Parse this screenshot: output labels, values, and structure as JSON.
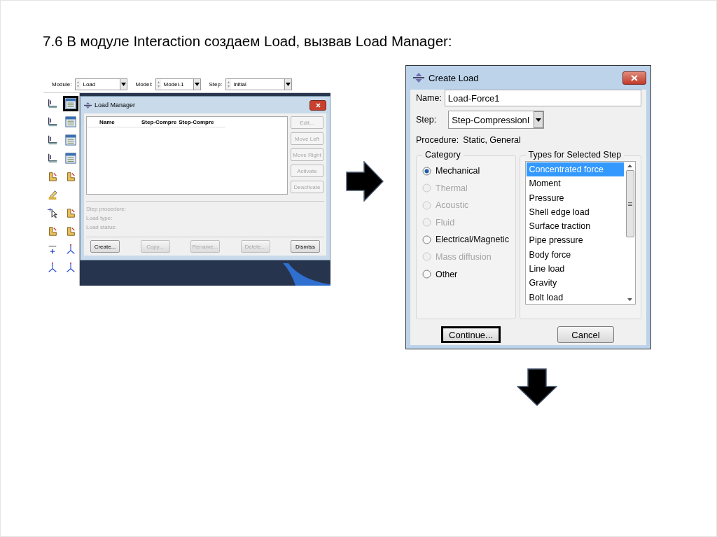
{
  "heading": "7.6 В модуле Interaction создаем Load, вызвав Load Manager:",
  "abaqus_screenshot": {
    "context_bar": [
      {
        "label": "Module:",
        "value": "Load"
      },
      {
        "label": "Model:",
        "value": "Model-1"
      },
      {
        "label": "Step:",
        "value": "Initial"
      }
    ],
    "toolbox": [
      {
        "kind": "support",
        "selected": false
      },
      {
        "kind": "manager",
        "selected": true
      },
      {
        "kind": "support",
        "selected": false
      },
      {
        "kind": "manager",
        "selected": false
      },
      {
        "kind": "support",
        "selected": false
      },
      {
        "kind": "manager",
        "selected": false
      },
      {
        "kind": "support",
        "selected": false
      },
      {
        "kind": "manager",
        "selected": false
      },
      {
        "kind": "part",
        "selected": false
      },
      {
        "kind": "part",
        "selected": false
      },
      {
        "kind": "pencil",
        "selected": false
      },
      {
        "kind": "blank",
        "selected": false
      },
      {
        "kind": "cursor",
        "selected": false
      },
      {
        "kind": "part",
        "selected": false
      },
      {
        "kind": "part",
        "selected": false
      },
      {
        "kind": "part",
        "selected": false
      },
      {
        "kind": "xyz",
        "selected": false
      },
      {
        "kind": "axes",
        "selected": false
      },
      {
        "kind": "axes",
        "selected": false
      },
      {
        "kind": "axes",
        "selected": false
      }
    ],
    "load_manager": {
      "title": "Load Manager",
      "columns": [
        "Name",
        "Step-Compre",
        "Step-Compre"
      ],
      "side_buttons": [
        {
          "label": "Edit...",
          "disabled": true
        },
        {
          "label": "Move Left",
          "disabled": true
        },
        {
          "label": "Move Right",
          "disabled": true
        },
        {
          "label": "Activate",
          "disabled": true
        },
        {
          "label": "Deactivate",
          "disabled": true
        }
      ],
      "info": [
        "Step procedure:",
        "Load type:",
        "Load status:"
      ],
      "buttons": [
        {
          "label": "Create...",
          "disabled": false
        },
        {
          "label": "Copy...",
          "disabled": true
        },
        {
          "label": "Rename...",
          "disabled": true
        },
        {
          "label": "Delete...",
          "disabled": true
        },
        {
          "label": "Dismiss",
          "disabled": false
        }
      ]
    }
  },
  "create_load": {
    "title": "Create Load",
    "name": {
      "label": "Name:",
      "value": "Load-Force1"
    },
    "step": {
      "label": "Step:",
      "value": "Step-CompressionI"
    },
    "procedure": {
      "label": "Procedure:",
      "value": "Static, General"
    },
    "category": {
      "title": "Category",
      "options": [
        {
          "label": "Mechanical",
          "selected": true,
          "disabled": false
        },
        {
          "label": "Thermal",
          "selected": false,
          "disabled": true
        },
        {
          "label": "Acoustic",
          "selected": false,
          "disabled": true
        },
        {
          "label": "Fluid",
          "selected": false,
          "disabled": true
        },
        {
          "label": "Electrical/Magnetic",
          "selected": false,
          "disabled": false
        },
        {
          "label": "Mass diffusion",
          "selected": false,
          "disabled": true
        },
        {
          "label": "Other",
          "selected": false,
          "disabled": false
        }
      ]
    },
    "types": {
      "title": "Types for Selected Step",
      "items": [
        {
          "label": "Concentrated force",
          "selected": true
        },
        {
          "label": "Moment",
          "selected": false
        },
        {
          "label": "Pressure",
          "selected": false
        },
        {
          "label": "Shell edge load",
          "selected": false
        },
        {
          "label": "Surface traction",
          "selected": false
        },
        {
          "label": "Pipe pressure",
          "selected": false
        },
        {
          "label": "Body force",
          "selected": false
        },
        {
          "label": "Line load",
          "selected": false
        },
        {
          "label": "Gravity",
          "selected": false
        },
        {
          "label": "Bolt load",
          "selected": false
        }
      ]
    },
    "buttons": [
      {
        "label": "Continue...",
        "focused": true
      },
      {
        "label": "Cancel",
        "focused": false
      }
    ]
  }
}
